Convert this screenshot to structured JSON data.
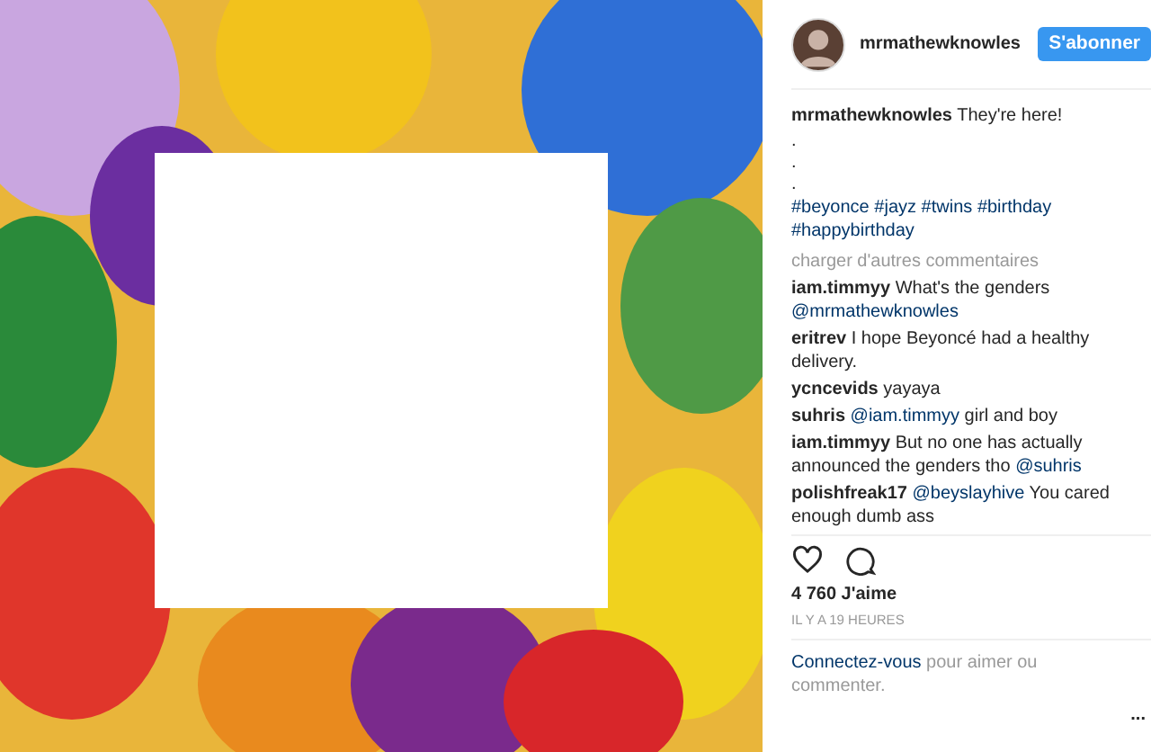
{
  "header": {
    "username": "mrmathewknowles",
    "follow_button": "S'abonner"
  },
  "caption": {
    "username": "mrmathewknowles",
    "text": "They're here!",
    "lines": [
      ".",
      ".",
      "."
    ],
    "hashtags": [
      "#beyonce",
      "#jayz",
      "#twins",
      "#birthday",
      "#happybirthday"
    ]
  },
  "load_more": "charger d'autres commentaires",
  "comments": [
    {
      "username": "iam.timmyy",
      "parts": [
        {
          "kind": "text",
          "text": "What's the genders"
        },
        {
          "kind": "mention",
          "text": "@mrmathewknowles"
        }
      ]
    },
    {
      "username": "eritrev",
      "parts": [
        {
          "kind": "text",
          "text": "I hope Beyoncé had a healthy delivery."
        }
      ]
    },
    {
      "username": "ycncevids",
      "parts": [
        {
          "kind": "text",
          "text": "yayaya"
        }
      ]
    },
    {
      "username": "suhris",
      "parts": [
        {
          "kind": "mention",
          "text": "@iam.timmyy"
        },
        {
          "kind": "text",
          "text": "girl and boy"
        }
      ]
    },
    {
      "username": "iam.timmyy",
      "parts": [
        {
          "kind": "text",
          "text": "But no one has actually announced the genders tho"
        },
        {
          "kind": "mention",
          "text": "@suhris"
        }
      ]
    },
    {
      "username": "polishfreak17",
      "parts": [
        {
          "kind": "mention",
          "text": "@beyslayhive"
        },
        {
          "kind": "text",
          "text": "You cared enough dumb ass"
        }
      ]
    }
  ],
  "actions": {
    "liked": false
  },
  "likes": "4 760 J'aime",
  "time": "IL Y A 19 HEURES",
  "login": {
    "link": "Connectez-vous",
    "text": "pour aimer ou commenter."
  },
  "more": "..."
}
